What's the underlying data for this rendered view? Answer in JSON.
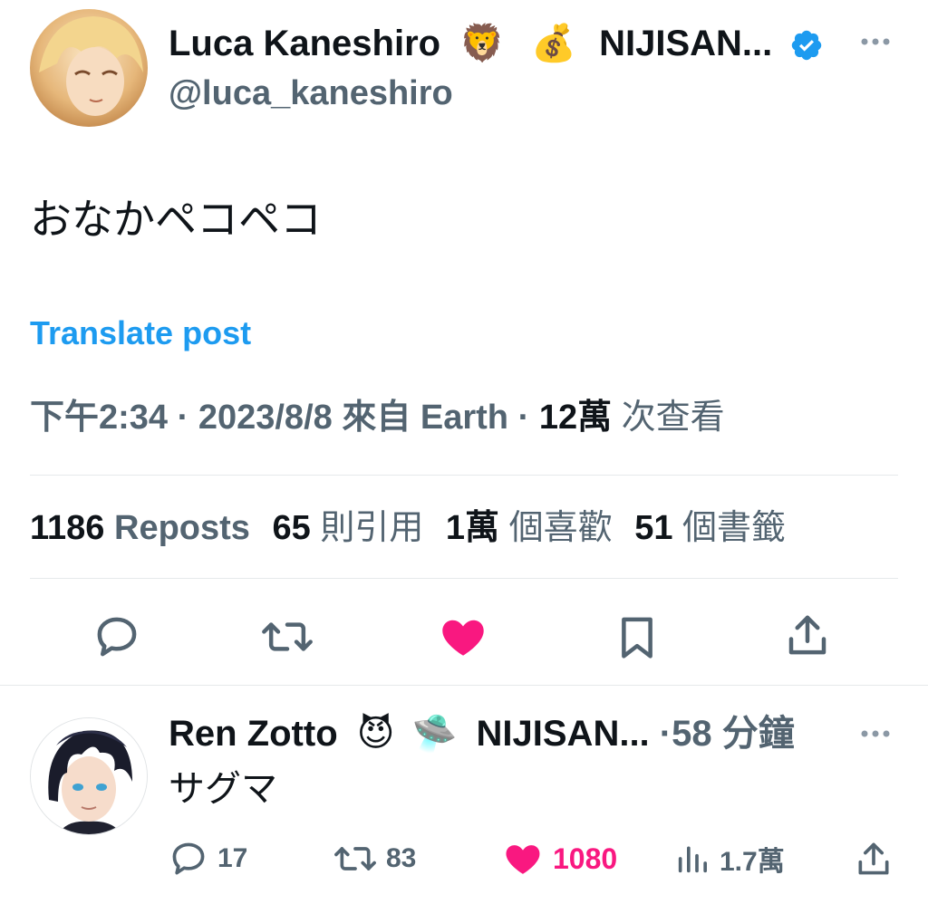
{
  "main_tweet": {
    "author_name": "Luca Kaneshiro",
    "author_emojis": [
      "🦁",
      "💰"
    ],
    "author_suffix": "NIJISAN...",
    "handle": "@luca_kaneshiro",
    "text": "おなかペコペコ",
    "translate_label": "Translate post",
    "time": "下午2:34",
    "date": "2023/8/8",
    "source": "來自 Earth",
    "views_count": "12萬",
    "views_label": "次查看",
    "stats": {
      "reposts_count": "1186",
      "reposts_label": "Reposts",
      "quotes_count": "65",
      "quotes_label": "則引用",
      "likes_count": "1萬",
      "likes_label": "個喜歡",
      "bookmarks_count": "51",
      "bookmarks_label": "個書籤"
    }
  },
  "reply": {
    "author_name": "Ren Zotto",
    "author_emojis": [
      "😈",
      "🛸"
    ],
    "author_suffix": "NIJISAN...",
    "time_ago": "·58 分鐘",
    "text": "サグマ",
    "replies": "17",
    "reposts": "83",
    "likes": "1080",
    "views": "1.7萬"
  },
  "separator": "·",
  "colors": {
    "accent": "#1d9bf0",
    "like": "#f91880",
    "muted": "#536471",
    "text": "#0f1419"
  },
  "icons": [
    "reply-icon",
    "repost-icon",
    "heart-icon",
    "bookmark-icon",
    "share-icon",
    "more-icon",
    "verified-badge-icon",
    "views-icon"
  ]
}
